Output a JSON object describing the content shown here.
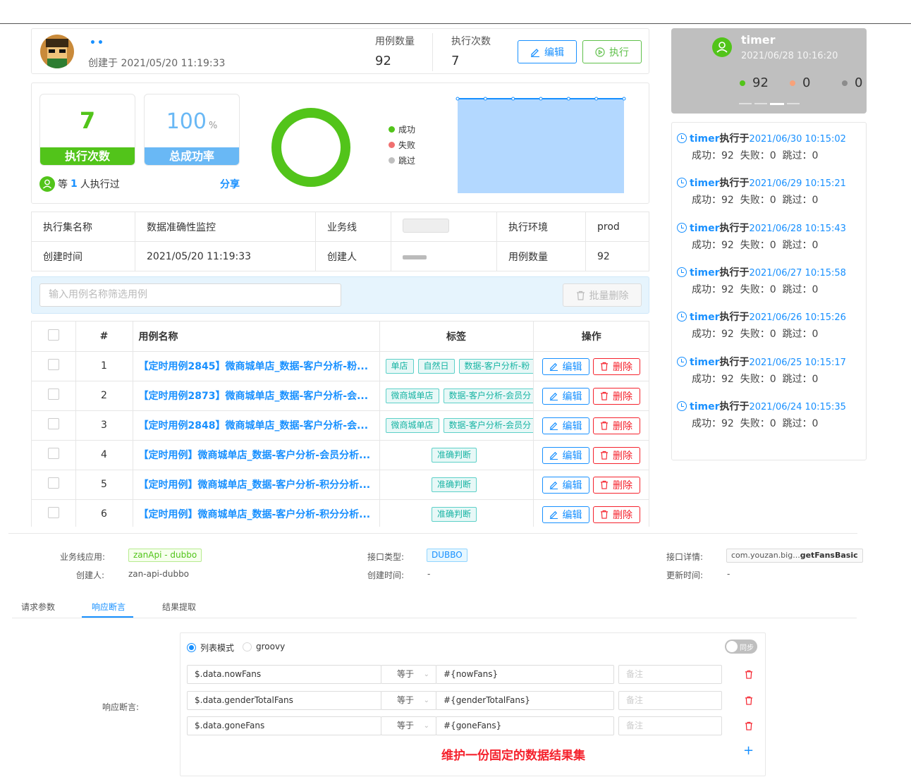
{
  "header": {
    "user_name": "••",
    "created_at": "创建于 2021/05/20 11:19:33",
    "case_count_label": "用例数量",
    "case_count": "92",
    "exec_count_label": "执行次数",
    "exec_count": "7",
    "edit_btn": "编辑",
    "run_btn": "执行"
  },
  "timer_card": {
    "name": "timer",
    "time": "2021/06/28 10:16:20",
    "success": "92",
    "fail": "0",
    "skip": "0"
  },
  "stats": {
    "exec_value": "7",
    "exec_label": "执行次数",
    "rate_value": "100",
    "rate_unit": "%",
    "rate_label": "总成功率",
    "executors_prefix": "等",
    "executors_count": "1",
    "executors_suffix": "人执行过",
    "share": "分享",
    "legend": [
      "成功",
      "失败",
      "跳过"
    ],
    "colors": {
      "success": "#52c41a",
      "fail": "#f5222d",
      "skip": "#bfbfbf",
      "band_exec": "#52c41a",
      "band_rate": "#69b8f5"
    }
  },
  "chart_data": {
    "type": "area",
    "x": [
      1,
      2,
      3,
      4,
      5,
      6,
      7
    ],
    "series": [
      {
        "values": [
          92,
          92,
          92,
          92,
          92,
          92,
          92
        ]
      }
    ],
    "donut": {
      "success": 92,
      "fail": 0,
      "skip": 0
    }
  },
  "info": {
    "r1": [
      "执行集名称",
      "数据准确性监控",
      "业务线",
      "",
      "执行环境",
      "prod"
    ],
    "r2": [
      "创建时间",
      "2021/05/20 11:19:33",
      "创建人",
      "",
      "用例数量",
      "92"
    ]
  },
  "filter": {
    "placeholder": "输入用例名称筛选用例",
    "batch_delete": "批量删除"
  },
  "table": {
    "headers": [
      "#",
      "用例名称",
      "标签",
      "操作"
    ],
    "edit": "编辑",
    "delete": "删除",
    "rows": [
      {
        "no": "1",
        "name": "【定时用例2845】微商城单店_数据-客户分析-粉...",
        "tags": [
          "单店",
          "自然日",
          "数据-客户分析-粉"
        ]
      },
      {
        "no": "2",
        "name": "【定时用例2873】微商城单店_数据-客户分析-会...",
        "tags": [
          "微商城单店",
          "数据-客户分析-会员分"
        ]
      },
      {
        "no": "3",
        "name": "【定时用例2848】微商城单店_数据-客户分析-会...",
        "tags": [
          "微商城单店",
          "数据-客户分析-会员分"
        ]
      },
      {
        "no": "4",
        "name": "【定时用例】微商城单店_数据-客户分析-会员分析...",
        "tags": [
          "准确判断"
        ]
      },
      {
        "no": "5",
        "name": "【定时用例】微商城单店_数据-客户分析-积分分析...",
        "tags": [
          "准确判断"
        ]
      },
      {
        "no": "6",
        "name": "【定时用例】微商城单店_数据-客户分析-积分分析...",
        "tags": [
          "准确判断"
        ]
      }
    ]
  },
  "timeline": {
    "name": "timer",
    "action": "执行于",
    "items": [
      {
        "time": "2021/06/30 10:15:02",
        "result": "成功：92  失败：0  跳过：0"
      },
      {
        "time": "2021/06/29 10:15:21",
        "result": "成功：92  失败：0  跳过：0"
      },
      {
        "time": "2021/06/28 10:15:43",
        "result": "成功：92  失败：0  跳过：0"
      },
      {
        "time": "2021/06/27 10:15:58",
        "result": "成功：92  失败：0  跳过：0"
      },
      {
        "time": "2021/06/26 10:15:26",
        "result": "成功：92  失败：0  跳过：0"
      },
      {
        "time": "2021/06/25 10:15:17",
        "result": "成功：92  失败：0  跳过：0"
      },
      {
        "time": "2021/06/24 10:15:35",
        "result": "成功：92  失败：0  跳过：0"
      }
    ]
  },
  "api": {
    "app_label": "业务线应用:",
    "app_value": "zanApi - dubbo",
    "creator_label": "创建人:",
    "creator_value": "zan-api-dubbo",
    "type_label": "接口类型:",
    "type_value": "DUBBO",
    "ctime_label": "创建时间:",
    "ctime_value": "-",
    "detail_label": "接口详情:",
    "detail_prefix": "com.youzan.big...",
    "detail_method": "getFansBasic",
    "mtime_label": "更新时间:",
    "mtime_value": "-"
  },
  "tabs": [
    "请求参数",
    "响应断言",
    "结果提取"
  ],
  "assert": {
    "mode_list": "列表模式",
    "mode_groovy": "groovy",
    "sync": "同步",
    "label": "响应断言:",
    "rows": [
      {
        "path": "$.data.nowFans",
        "op": "等于",
        "expect": "#{nowFans}",
        "note": "备注"
      },
      {
        "path": "$.data.genderTotalFans",
        "op": "等于",
        "expect": "#{genderTotalFans}",
        "note": "备注"
      },
      {
        "path": "$.data.goneFans",
        "op": "等于",
        "expect": "#{goneFans}",
        "note": "备注"
      }
    ],
    "annotation": "维护一份固定的数据结果集"
  }
}
